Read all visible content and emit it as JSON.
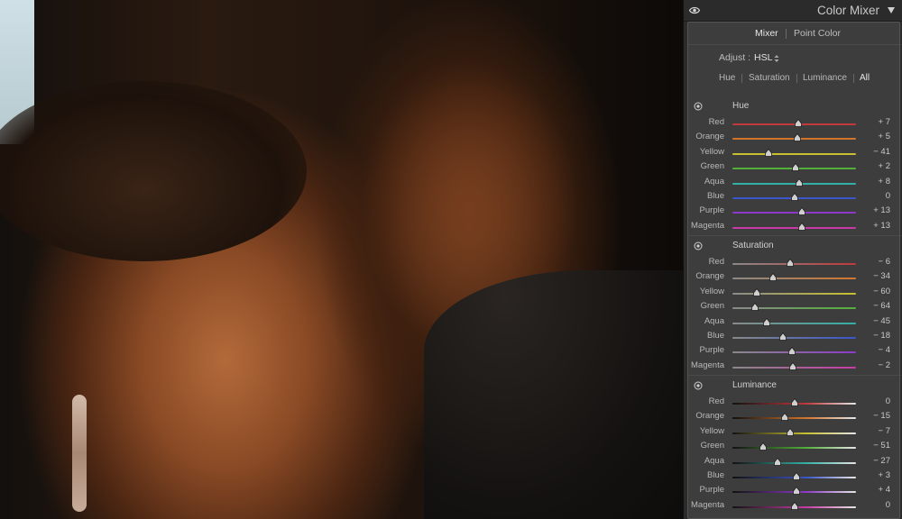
{
  "panel": {
    "title": "Color Mixer",
    "mode_tabs": [
      "Mixer",
      "Point Color"
    ],
    "adjust_label": "Adjust :",
    "adjust_value": "HSL",
    "sub_tabs": [
      "Hue",
      "Saturation",
      "Luminance",
      "All"
    ]
  },
  "sections": [
    {
      "title": "Hue",
      "rows": [
        {
          "label": "Red",
          "value": "+ 7"
        },
        {
          "label": "Orange",
          "value": "+ 5"
        },
        {
          "label": "Yellow",
          "value": "− 41"
        },
        {
          "label": "Green",
          "value": "+ 2"
        },
        {
          "label": "Aqua",
          "value": "+ 8"
        },
        {
          "label": "Blue",
          "value": "0"
        },
        {
          "label": "Purple",
          "value": "+ 13"
        },
        {
          "label": "Magenta",
          "value": "+ 13"
        }
      ]
    },
    {
      "title": "Saturation",
      "rows": [
        {
          "label": "Red",
          "value": "− 6"
        },
        {
          "label": "Orange",
          "value": "− 34"
        },
        {
          "label": "Yellow",
          "value": "− 60"
        },
        {
          "label": "Green",
          "value": "− 64"
        },
        {
          "label": "Aqua",
          "value": "− 45"
        },
        {
          "label": "Blue",
          "value": "− 18"
        },
        {
          "label": "Purple",
          "value": "− 4"
        },
        {
          "label": "Magenta",
          "value": "− 2"
        }
      ]
    },
    {
      "title": "Luminance",
      "rows": [
        {
          "label": "Red",
          "value": "0"
        },
        {
          "label": "Orange",
          "value": "− 15"
        },
        {
          "label": "Yellow",
          "value": "− 7"
        },
        {
          "label": "Green",
          "value": "− 51"
        },
        {
          "label": "Aqua",
          "value": "− 27"
        },
        {
          "label": "Blue",
          "value": "+ 3"
        },
        {
          "label": "Purple",
          "value": "+ 4"
        },
        {
          "label": "Magenta",
          "value": "0"
        }
      ]
    }
  ],
  "slider_colors": {
    "Red": "#c0393b",
    "Orange": "#d2752c",
    "Yellow": "#c8c030",
    "Green": "#52b03a",
    "Aqua": "#35b0a6",
    "Blue": "#3a56c8",
    "Purple": "#8e3ac8",
    "Magenta": "#c83aa6"
  },
  "icons": {
    "visibility": "eye-icon",
    "collapse": "triangle-down-icon",
    "adjust_menu": "updown-arrows-icon",
    "targeted_adjustment": "target-icon"
  }
}
